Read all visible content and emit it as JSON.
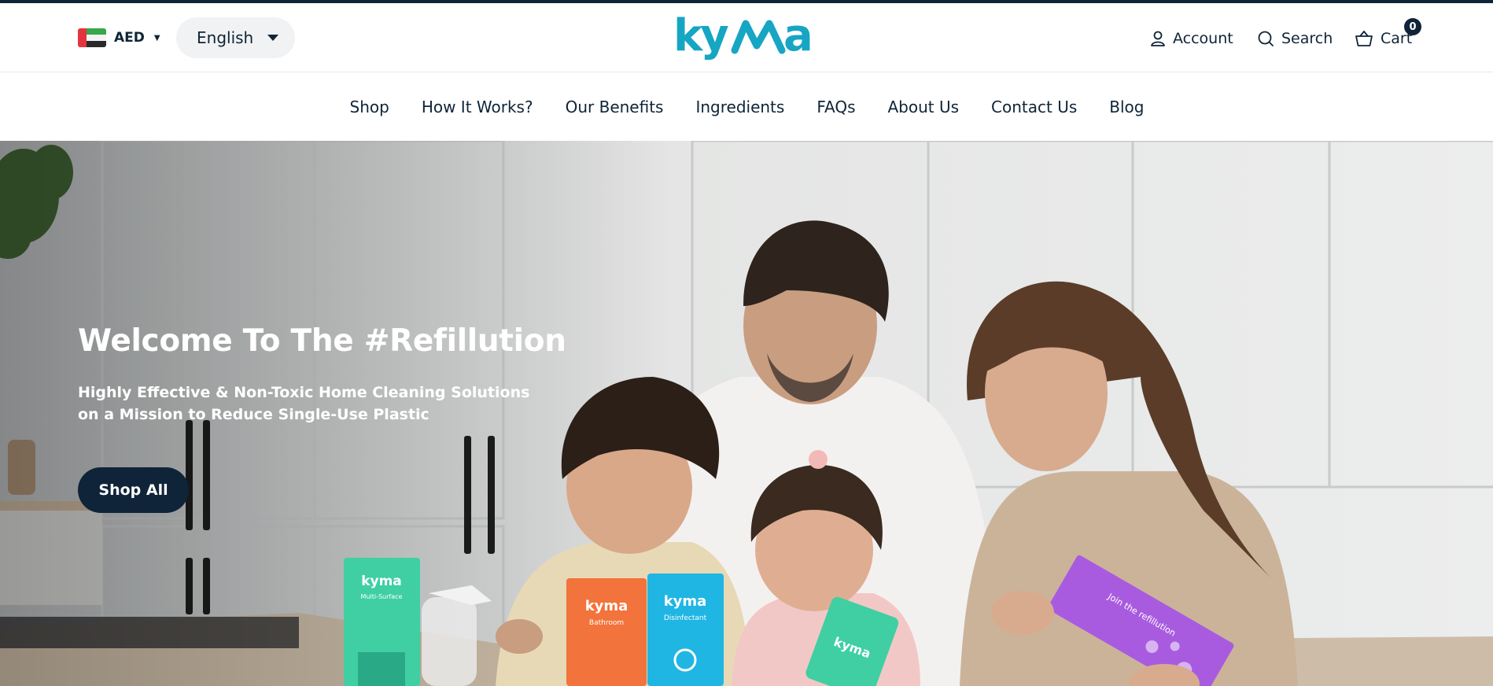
{
  "header": {
    "currency": {
      "code": "AED",
      "flag": "uae-flag-icon"
    },
    "language": {
      "selected": "English"
    },
    "logo": {
      "text": "kyma",
      "color": "#16a6c3"
    },
    "account_label": "Account",
    "search_label": "Search",
    "cart_label": "Cart",
    "cart_count": "0"
  },
  "nav": {
    "items": [
      {
        "label": "Shop"
      },
      {
        "label": "How It Works?"
      },
      {
        "label": "Our Benefits"
      },
      {
        "label": "Ingredients"
      },
      {
        "label": "FAQs"
      },
      {
        "label": "About Us"
      },
      {
        "label": "Contact Us"
      },
      {
        "label": "Blog"
      }
    ]
  },
  "hero": {
    "title": "Welcome To The #Refillution",
    "subtitle": "Highly Effective & Non-Toxic Home Cleaning Solutions on a Mission to Reduce Single-Use Plastic",
    "cta_label": "Shop All",
    "image": "family-with-kyma-cleaning-products-photo",
    "product_labels": {
      "multi_surface_brand": "kyma",
      "multi_surface_name": "Multi-Surface",
      "bathroom_brand": "kyma",
      "bathroom_name": "Bathroom",
      "disinfectant_brand": "kyma",
      "disinfectant_name": "Disinfectant",
      "glass_brand": "kyma",
      "join_text": "Join the refillution"
    }
  },
  "colors": {
    "navy": "#0f2438",
    "brand_teal": "#16a6c3",
    "flag_red": "#e4343d",
    "flag_green": "#38a84a"
  }
}
